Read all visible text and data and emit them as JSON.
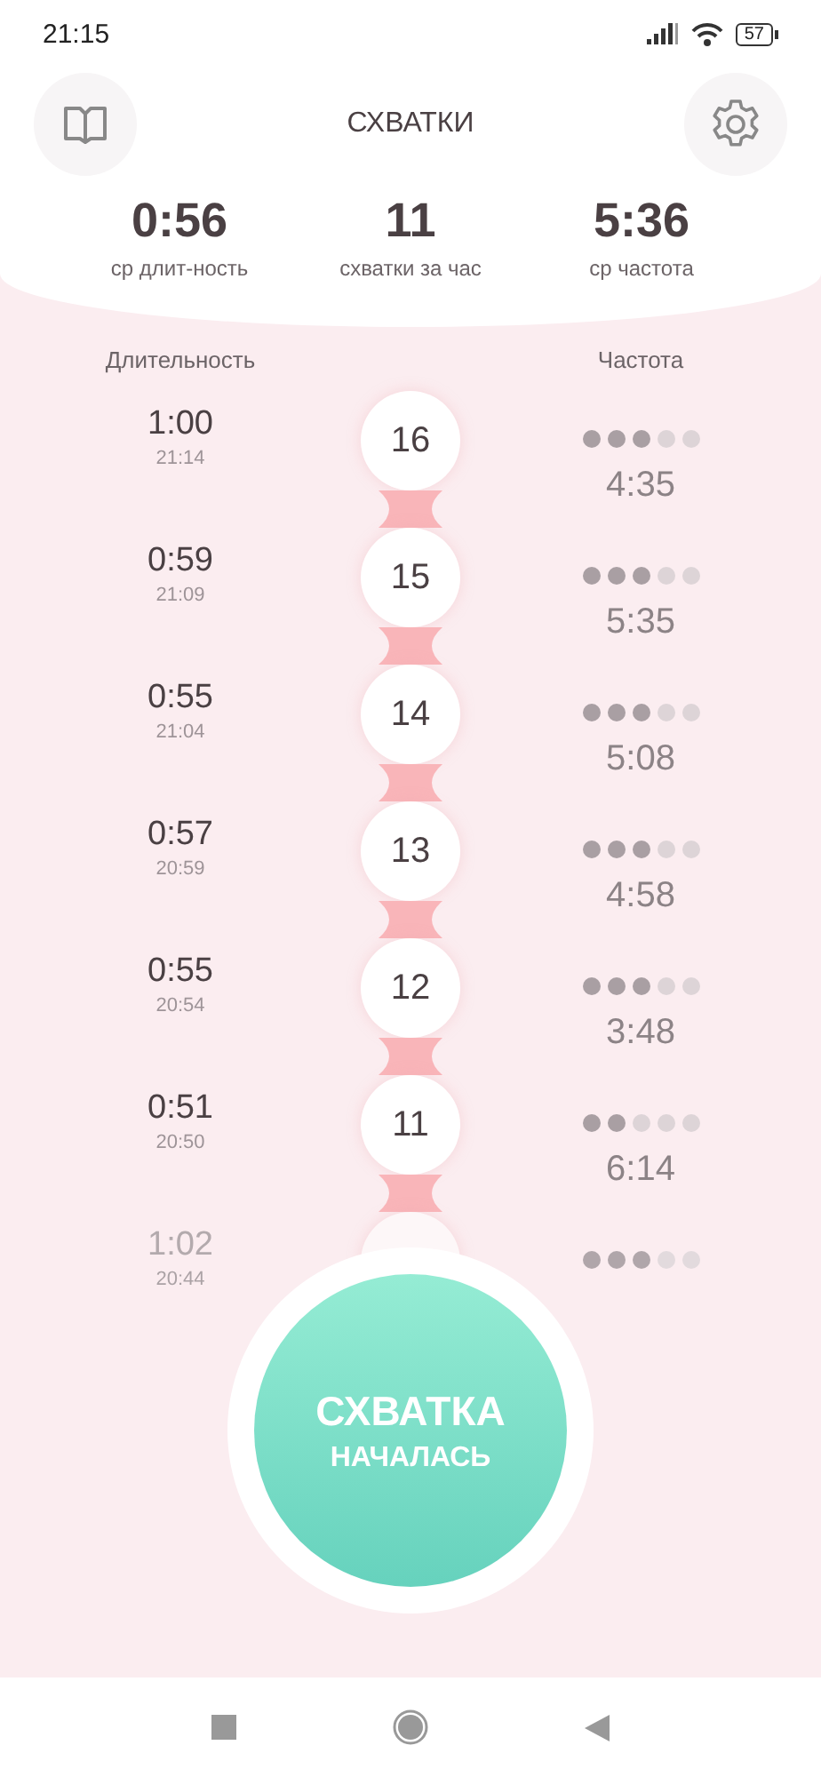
{
  "status_bar": {
    "time": "21:15",
    "battery": "57"
  },
  "header": {
    "title": "СХВАТКИ"
  },
  "stats": [
    {
      "value": "0:56",
      "label": "ср длит-ность"
    },
    {
      "value": "11",
      "label": "схватки за час"
    },
    {
      "value": "5:36",
      "label": "ср частота"
    }
  ],
  "columns": {
    "duration": "Длительность",
    "frequency": "Частота"
  },
  "contractions": [
    {
      "duration": "1:00",
      "time": "21:14",
      "number": "16",
      "stars": 3,
      "interval": "4:35",
      "faded": false
    },
    {
      "duration": "0:59",
      "time": "21:09",
      "number": "15",
      "stars": 3,
      "interval": "5:35",
      "faded": false
    },
    {
      "duration": "0:55",
      "time": "21:04",
      "number": "14",
      "stars": 3,
      "interval": "5:08",
      "faded": false
    },
    {
      "duration": "0:57",
      "time": "20:59",
      "number": "13",
      "stars": 3,
      "interval": "4:58",
      "faded": false
    },
    {
      "duration": "0:55",
      "time": "20:54",
      "number": "12",
      "stars": 3,
      "interval": "3:48",
      "faded": false
    },
    {
      "duration": "0:51",
      "time": "20:50",
      "number": "11",
      "stars": 2,
      "interval": "6:14",
      "faded": false
    },
    {
      "duration": "1:02",
      "time": "20:44",
      "stars": 3,
      "faded": true
    }
  ],
  "start_button": {
    "line_1": "СХВАТКА",
    "line_2": "НАЧАЛАСЬ"
  }
}
